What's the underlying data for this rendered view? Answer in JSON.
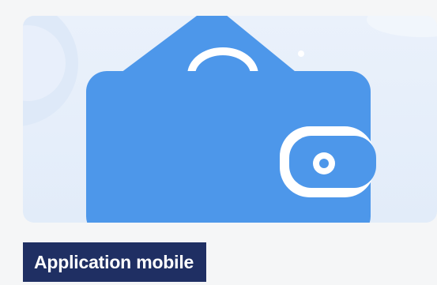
{
  "card": {
    "illustration_icon": "wallet-icon",
    "tag_label": "Application mobile"
  },
  "colors": {
    "hero_background": "#e6eefa",
    "wallet_blue": "#4d97ea",
    "tag_background": "#1f2f63",
    "tag_text": "#ffffff"
  }
}
